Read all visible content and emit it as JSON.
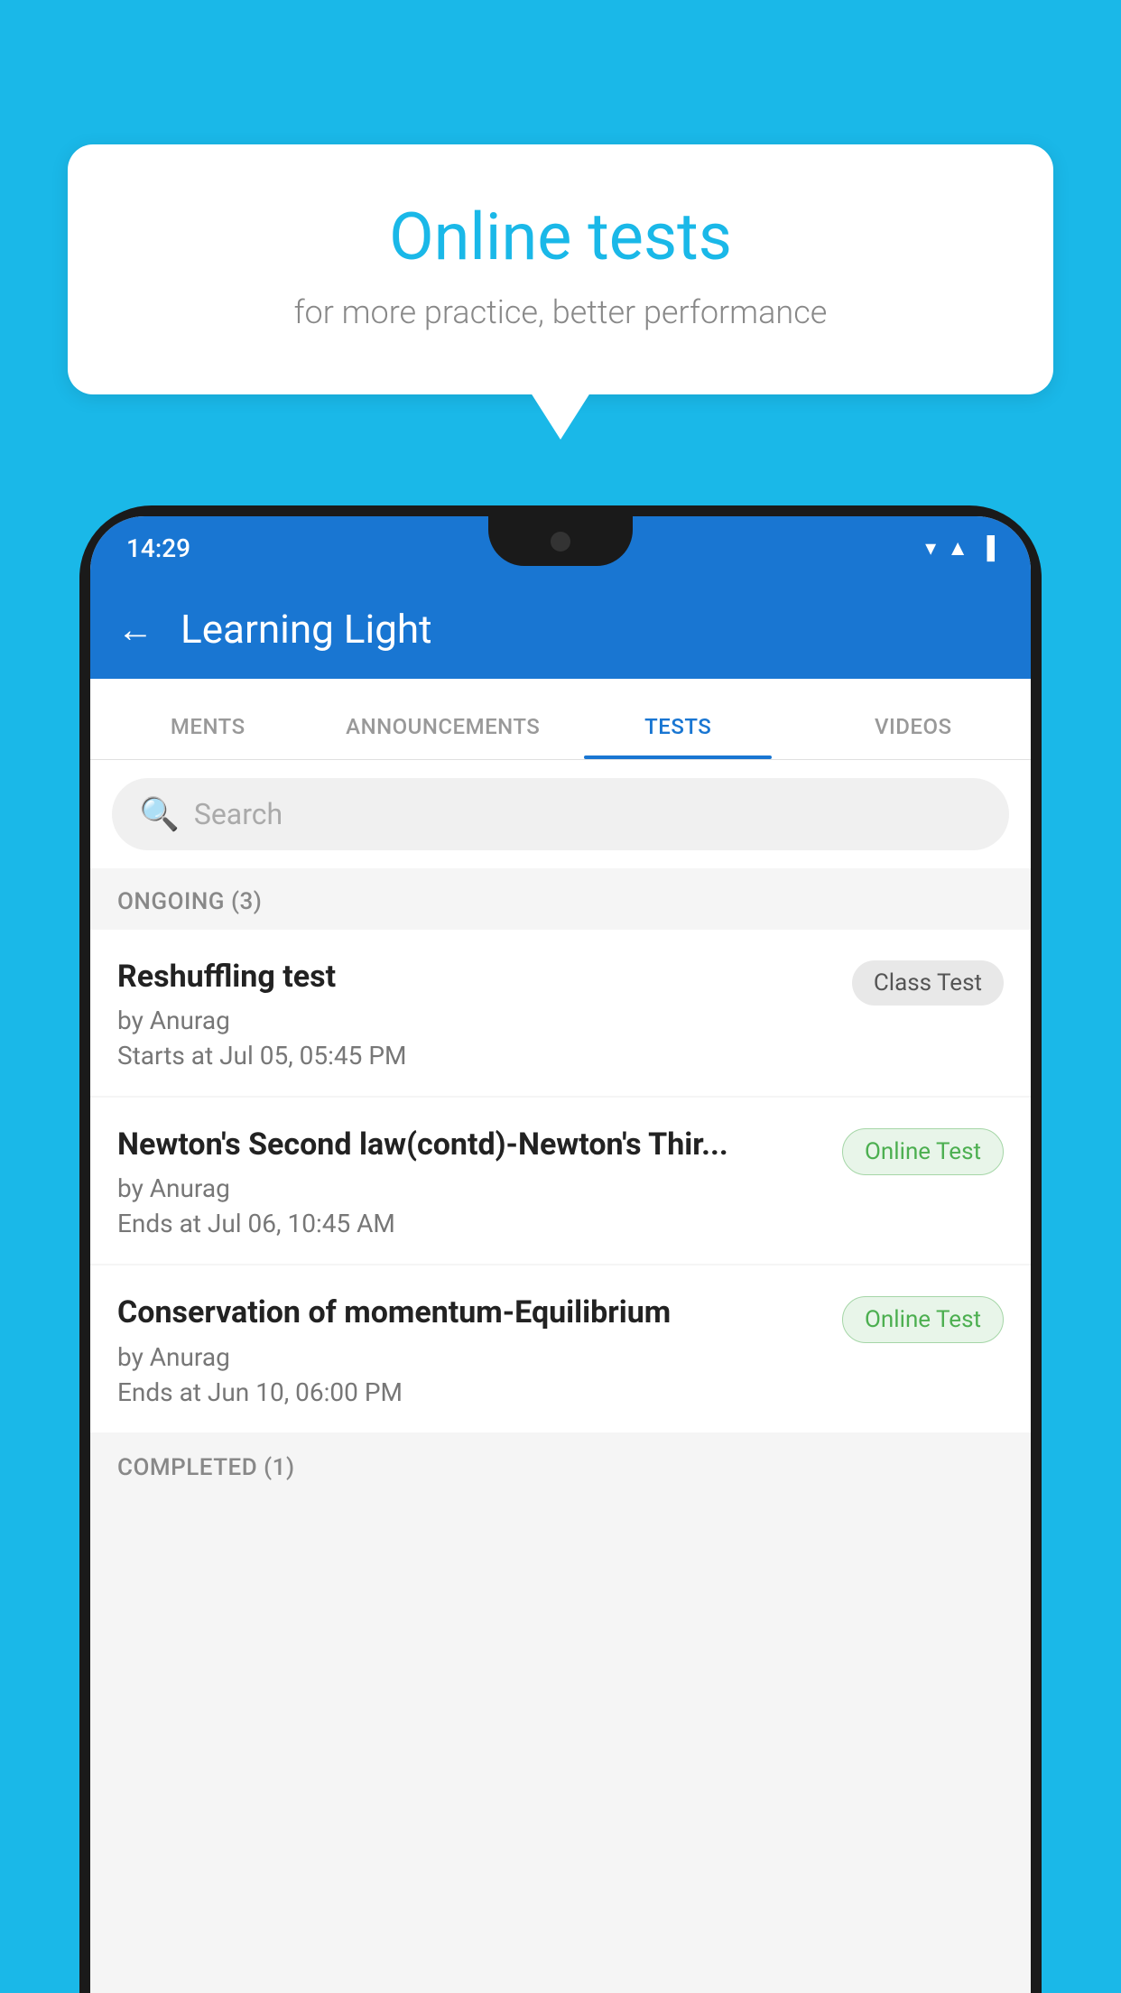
{
  "background": {
    "color": "#1ab8e8"
  },
  "speech_bubble": {
    "title": "Online tests",
    "subtitle": "for more practice, better performance"
  },
  "phone": {
    "status_bar": {
      "time": "14:29",
      "wifi_icon": "▾",
      "signal_icon": "▲",
      "battery_icon": "▐"
    },
    "app_bar": {
      "back_label": "←",
      "title": "Learning Light"
    },
    "tabs": [
      {
        "label": "MENTS",
        "active": false
      },
      {
        "label": "ANNOUNCEMENTS",
        "active": false
      },
      {
        "label": "TESTS",
        "active": true
      },
      {
        "label": "VIDEOS",
        "active": false
      }
    ],
    "search": {
      "placeholder": "Search"
    },
    "section_ongoing": {
      "label": "ONGOING (3)"
    },
    "tests": [
      {
        "title": "Reshuffling test",
        "author": "by Anurag",
        "time_label": "Starts at",
        "time_value": "Jul 05, 05:45 PM",
        "badge": "Class Test",
        "badge_type": "class"
      },
      {
        "title": "Newton's Second law(contd)-Newton's Thir...",
        "author": "by Anurag",
        "time_label": "Ends at",
        "time_value": "Jul 06, 10:45 AM",
        "badge": "Online Test",
        "badge_type": "online"
      },
      {
        "title": "Conservation of momentum-Equilibrium",
        "author": "by Anurag",
        "time_label": "Ends at",
        "time_value": "Jun 10, 06:00 PM",
        "badge": "Online Test",
        "badge_type": "online"
      }
    ],
    "section_completed": {
      "label": "COMPLETED (1)"
    }
  }
}
